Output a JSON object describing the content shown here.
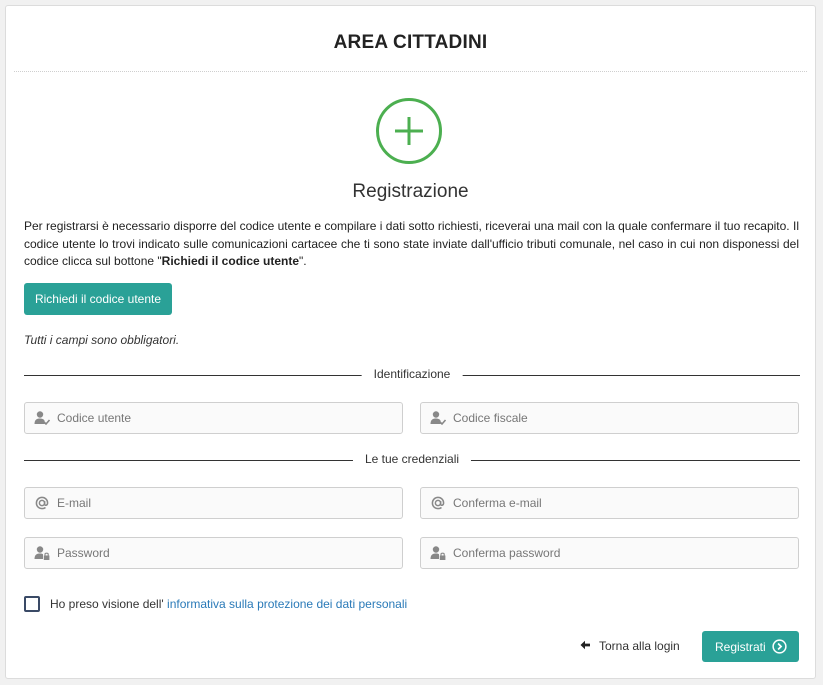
{
  "header": {
    "title": "AREA CITTADINI"
  },
  "registration": {
    "heading": "Registrazione",
    "intro_text": "Per registrarsi è necessario disporre del codice utente e compilare i dati sotto richiesti, riceverai una mail con la quale confermare il tuo recapito. Il codice utente lo trovi indicato sulle comunicazioni cartacee che ti sono state inviate dall'ufficio tributi comunale, nel caso in cui non disponessi del codice clicca sul bottone \"",
    "intro_bold": "Richiedi il codice utente",
    "intro_end": "\".",
    "request_code_button": "Richiedi il codice utente",
    "mandatory_note": "Tutti i campi sono obbligatori."
  },
  "sections": {
    "identification": "Identificazione",
    "credentials": "Le tue credenziali"
  },
  "fields": {
    "user_code": {
      "placeholder": "Codice utente",
      "icon": "user-check-icon"
    },
    "tax_code": {
      "placeholder": "Codice fiscale",
      "icon": "user-check-icon"
    },
    "email": {
      "placeholder": "E-mail",
      "icon": "at-icon"
    },
    "email_confirm": {
      "placeholder": "Conferma e-mail",
      "icon": "at-icon"
    },
    "password": {
      "placeholder": "Password",
      "icon": "user-lock-icon"
    },
    "password_confirm": {
      "placeholder": "Conferma password",
      "icon": "user-lock-icon"
    }
  },
  "consent": {
    "prefix": "Ho preso visione dell' ",
    "link": "informativa sulla protezione dei dati personali"
  },
  "footer": {
    "back_link": "Torna alla login",
    "register_button": "Registrati"
  },
  "colors": {
    "accent": "#2aa197",
    "plus_green": "#4caf50",
    "link": "#2a7ab8"
  }
}
